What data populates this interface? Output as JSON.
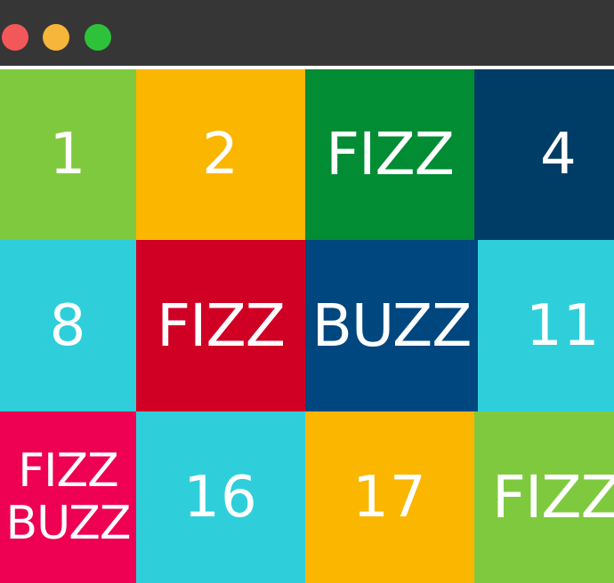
{
  "window": {
    "controls": [
      {
        "name": "close",
        "color": "#f2575a"
      },
      {
        "name": "minimize",
        "color": "#f6b53b"
      },
      {
        "name": "zoom",
        "color": "#2dc23a"
      }
    ]
  },
  "colors": {
    "lime": "#7fc93f",
    "amber": "#fbb600",
    "green": "#028c34",
    "navy": "#003d66",
    "cyan": "#2ecfdb",
    "red": "#d00025",
    "blue": "#00477f",
    "magenta": "#ee0052",
    "text": "#ffffff",
    "titlebar": "#363636"
  },
  "grid": {
    "rows": [
      [
        {
          "label": "1",
          "color": "#7fc93f"
        },
        {
          "label": "2",
          "color": "#fbb600"
        },
        {
          "label": "FIZZ",
          "color": "#028c34"
        },
        {
          "label": "4",
          "color": "#003d66"
        }
      ],
      [
        {
          "label": "8",
          "color": "#2ecfdb"
        },
        {
          "label": "FIZZ",
          "color": "#d00025"
        },
        {
          "label": "BUZZ",
          "color": "#00477f"
        },
        {
          "label": "11",
          "color": "#2ecfdb"
        }
      ],
      [
        {
          "label": "FIZZ",
          "label2": "BUZZ",
          "color": "#ee0052"
        },
        {
          "label": "16",
          "color": "#2ecfdb"
        },
        {
          "label": "17",
          "color": "#fbb600"
        },
        {
          "label": "FIZZ",
          "color": "#7fc93f"
        }
      ]
    ]
  }
}
